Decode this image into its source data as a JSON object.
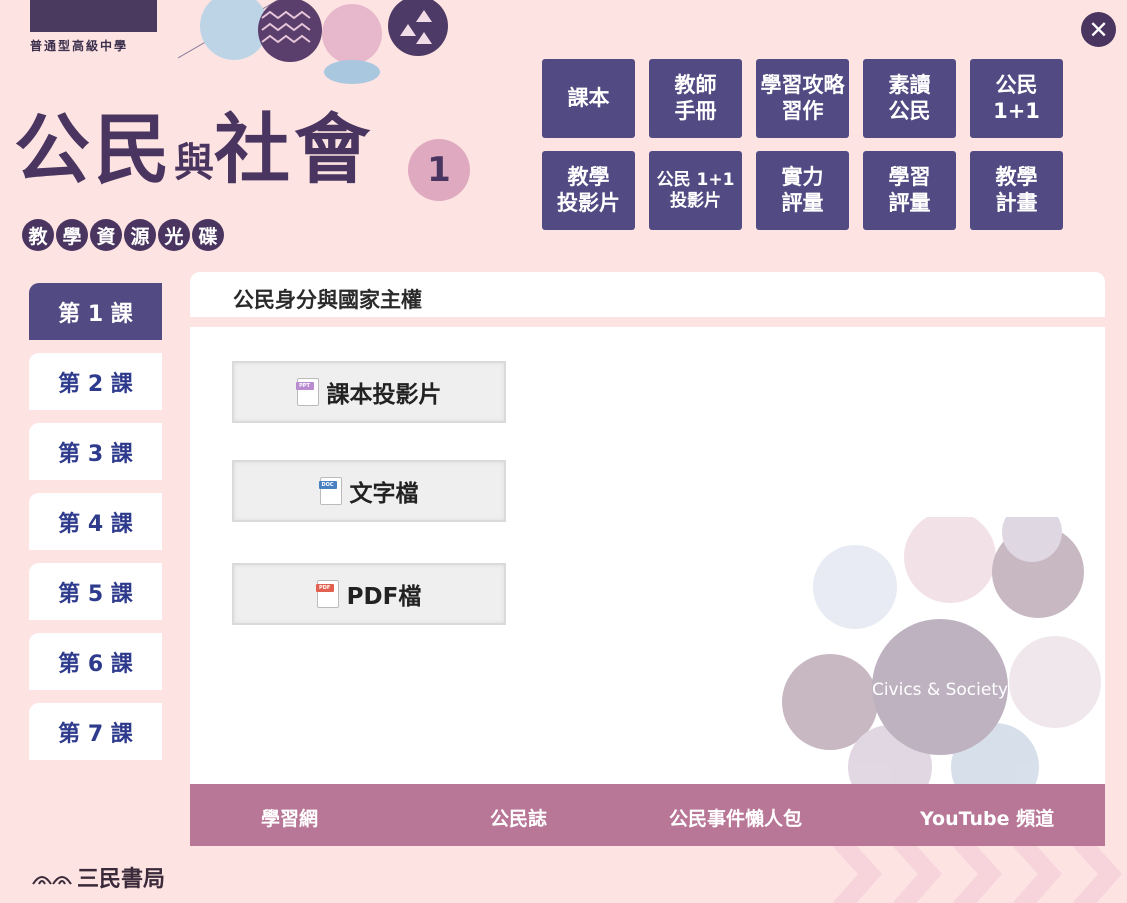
{
  "header": {
    "school_level": "普通型高級中學",
    "title_part1": "公民",
    "title_part2": "與",
    "title_part3": "社會",
    "volume": "1",
    "subtitle_chars": [
      "教",
      "學",
      "資",
      "源",
      "光",
      "碟"
    ],
    "close_symbol": "✕"
  },
  "resources": [
    {
      "label": "課本",
      "small": false
    },
    {
      "label": "教師\n手冊",
      "small": false
    },
    {
      "label": "學習攻略\n習作",
      "small": false
    },
    {
      "label": "素讀\n公民",
      "small": false
    },
    {
      "label": "公民\n1+1",
      "small": false
    },
    {
      "label": "教學\n投影片",
      "small": false
    },
    {
      "label": "公民 1+1\n投影片",
      "small": true
    },
    {
      "label": "實力\n評量",
      "small": false
    },
    {
      "label": "學習\n評量",
      "small": false
    },
    {
      "label": "教學\n計畫",
      "small": false
    }
  ],
  "lessons": [
    {
      "label": "第 1 課",
      "active": true
    },
    {
      "label": "第 2 課",
      "active": false
    },
    {
      "label": "第 3 課",
      "active": false
    },
    {
      "label": "第 4 課",
      "active": false
    },
    {
      "label": "第 5 課",
      "active": false
    },
    {
      "label": "第 6 課",
      "active": false
    },
    {
      "label": "第 7 課",
      "active": false
    }
  ],
  "content": {
    "title": "公民身分與國家主權",
    "files": [
      {
        "label": "課本投影片",
        "icon": "ppt-file-icon",
        "tag": "PPT",
        "color": "#b98bd0"
      },
      {
        "label": "文字檔",
        "icon": "doc-file-icon",
        "tag": "DOC",
        "color": "#4a7fc1"
      },
      {
        "label": "PDF檔",
        "icon": "pdf-file-icon",
        "tag": "PDF",
        "color": "#e2604f"
      }
    ],
    "deco_text": "Civics & Society"
  },
  "footer": {
    "links": [
      "學習網",
      "公民誌",
      "公民事件懶人包",
      "YouTube 頻道"
    ]
  },
  "publisher": "三民書局",
  "colors": {
    "background": "#fde4e2",
    "primary_purple": "#524a82",
    "footer_mauve": "#b97797",
    "lesson_text": "#2e3a8c"
  }
}
